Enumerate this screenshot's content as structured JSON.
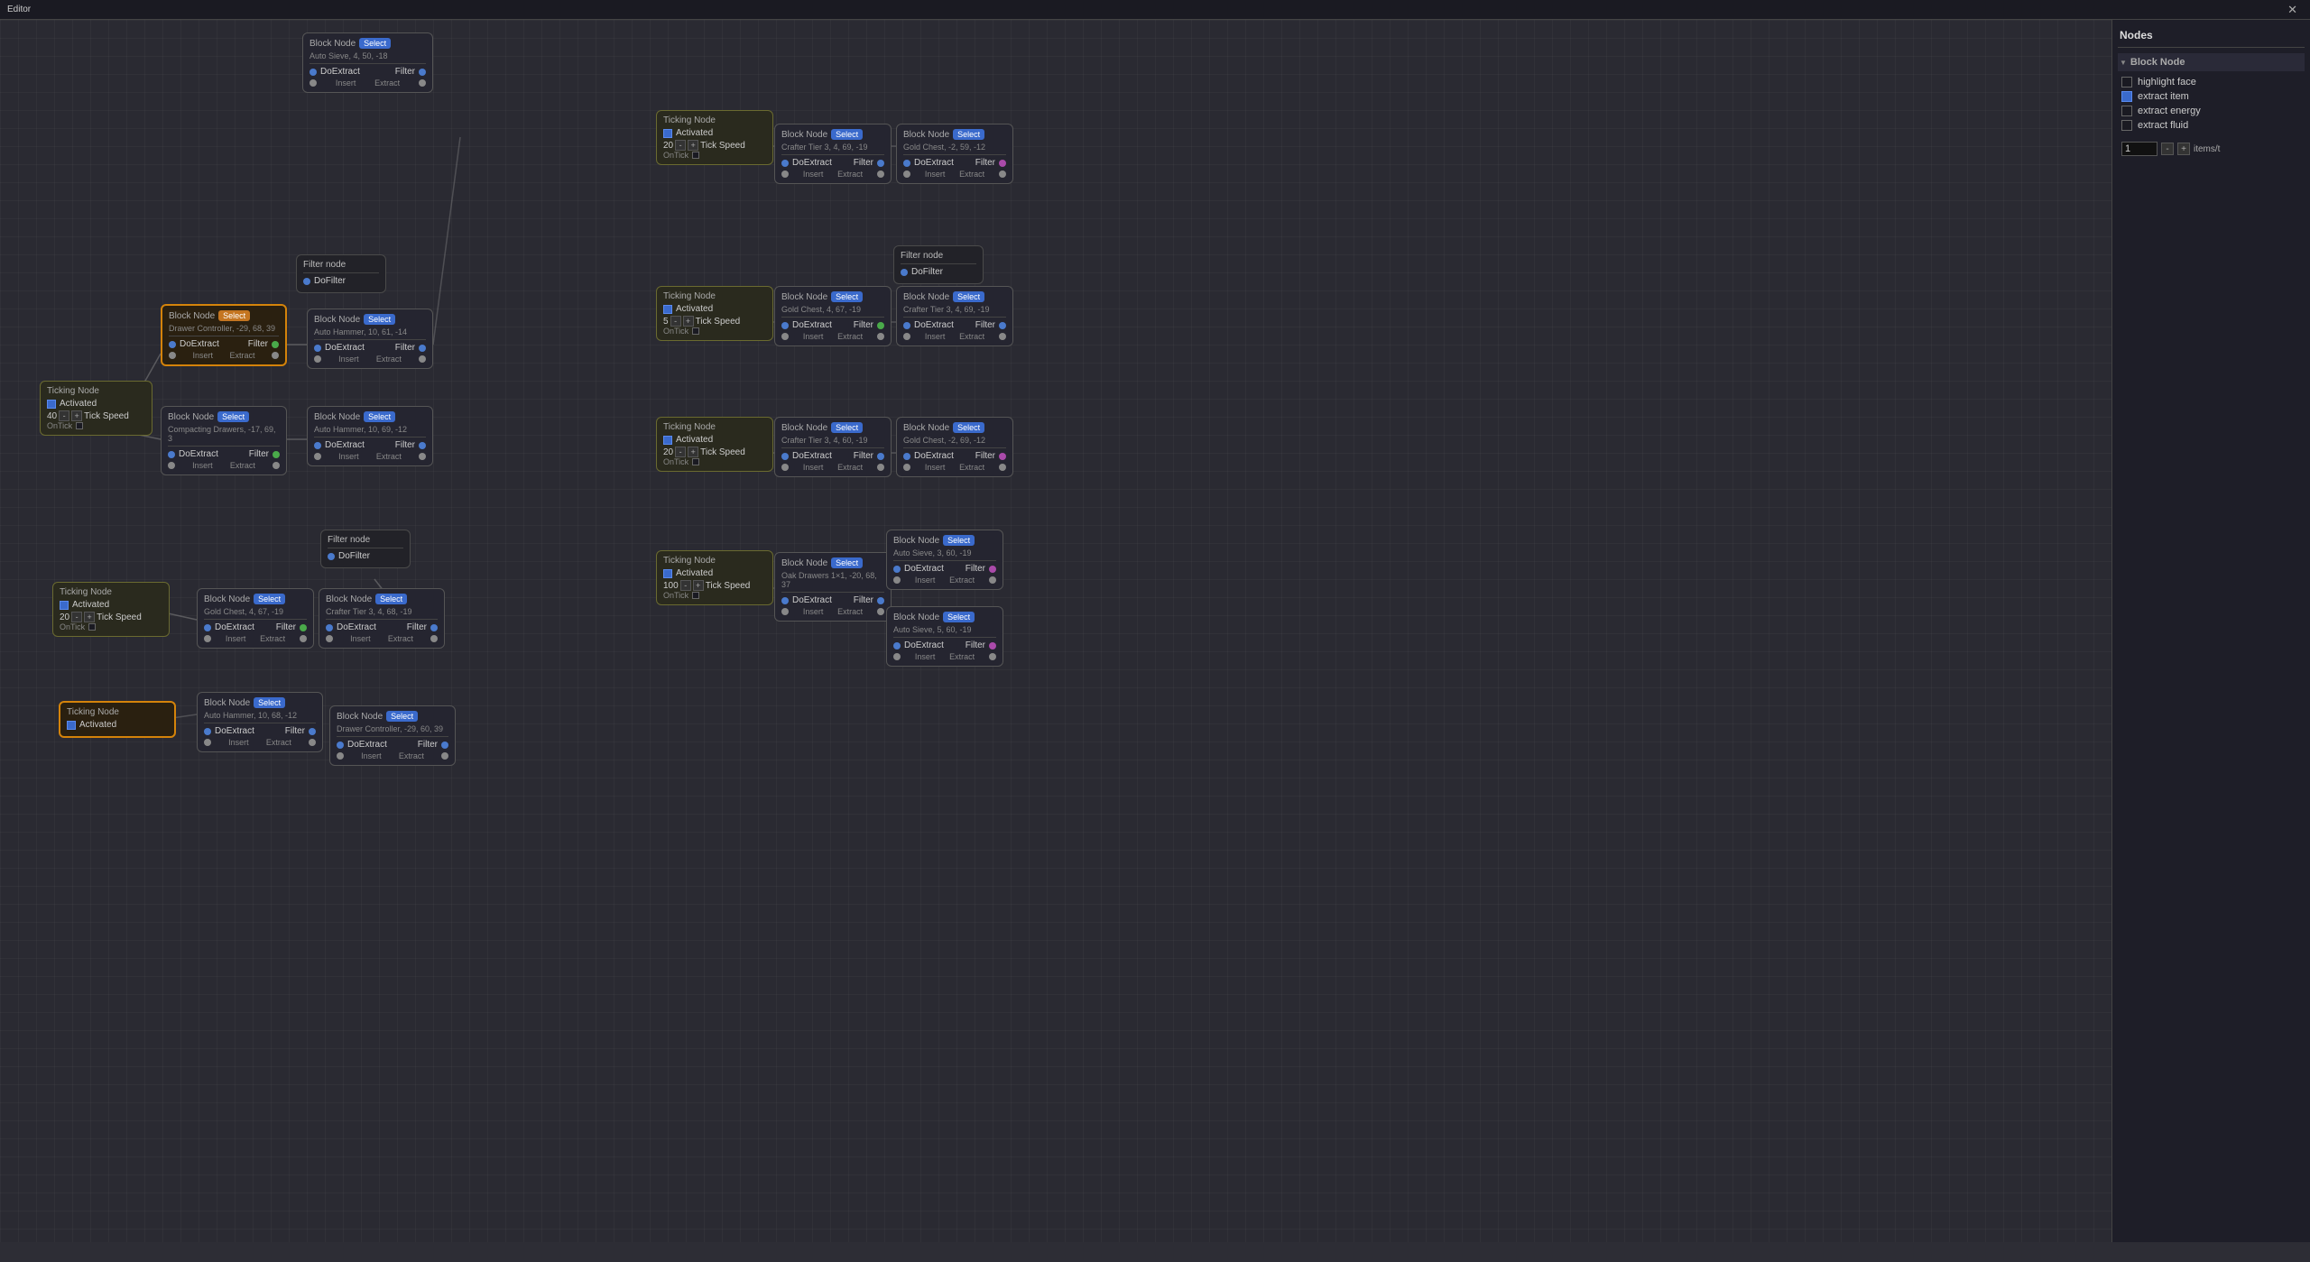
{
  "titlebar": {
    "title": "Editor",
    "close_label": "✕"
  },
  "sidebar": {
    "title": "Nodes",
    "section": "Block Node",
    "items": [
      {
        "id": "highlight-face",
        "label": "highlight face",
        "checked": false
      },
      {
        "id": "extract-item",
        "label": "extract item",
        "checked": true
      },
      {
        "id": "extract-energy",
        "label": "extract energy",
        "checked": false
      },
      {
        "id": "extract-fluid",
        "label": "extract fluid",
        "checked": false
      }
    ],
    "counter": {
      "value": "1",
      "unit": "items/t",
      "minus": "-",
      "plus": "+"
    }
  },
  "nodes": {
    "block1": {
      "type": "Block Node",
      "select": "Select",
      "coords": "Auto Sieve, 4, 50, -18",
      "doextract_label": "DoExtract",
      "filter_label": "Filter",
      "insert_label": "Insert",
      "extract_label": "Extract"
    },
    "ticking1": {
      "type": "Ticking Node",
      "activated": "Activated",
      "tick_speed": "Tick Speed",
      "tick_val": "20",
      "ontick": "OnTick"
    },
    "ticking_bottom": {
      "type": "Ticking Node Activated",
      "activated": "Activated"
    }
  }
}
